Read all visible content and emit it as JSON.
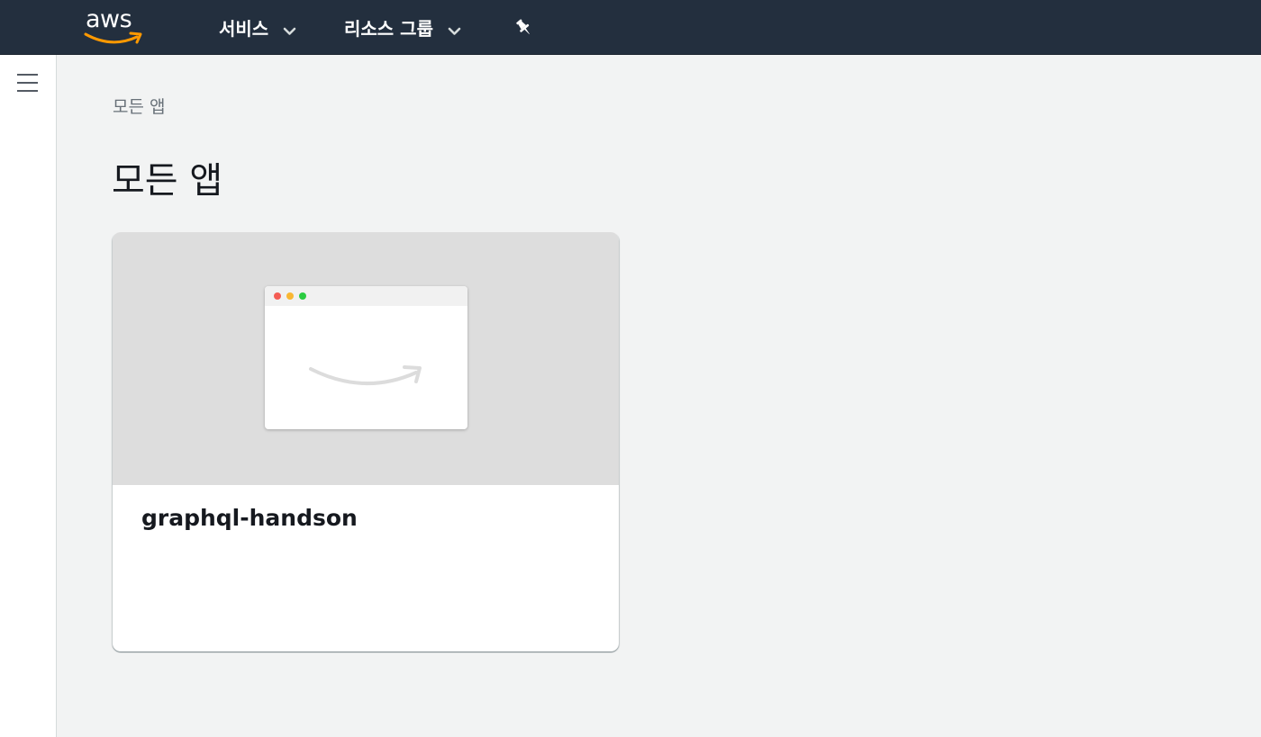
{
  "header": {
    "logo_text": "aws",
    "nav": [
      {
        "label": "서비스"
      },
      {
        "label": "리소스 그룹"
      }
    ]
  },
  "breadcrumb": {
    "label": "모든 앱"
  },
  "page": {
    "title": "모든 앱"
  },
  "apps": [
    {
      "name": "graphql-handson"
    }
  ],
  "colors": {
    "header_bg": "#232f3e",
    "page_bg": "#f2f3f3",
    "aws_orange": "#ff9900",
    "thumb_bg": "#dddddd"
  },
  "icons": {
    "menu": "hamburger-menu-icon",
    "pin": "pin-icon",
    "chevron": "chevron-down-icon",
    "smile": "amazon-smile-icon"
  }
}
